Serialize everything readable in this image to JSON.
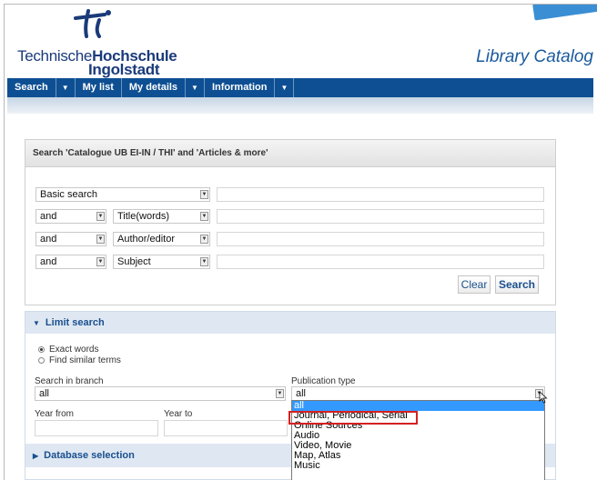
{
  "header": {
    "logo_line1_a": "Technische",
    "logo_line1_b": "Hochschule",
    "logo_line2": "Ingolstadt",
    "catalog_title": "Library Catalog"
  },
  "nav": {
    "items": [
      "Search",
      "My list",
      "My details",
      "Information"
    ],
    "arrow": "▼"
  },
  "search_panel": {
    "title": "Search 'Catalogue UB EI-IN / THI' and 'Articles & more'",
    "rows": [
      {
        "operator": "",
        "field": "Basic search"
      },
      {
        "operator": "and",
        "field": "Title(words)"
      },
      {
        "operator": "and",
        "field": "Author/editor"
      },
      {
        "operator": "and",
        "field": "Subject"
      }
    ],
    "clear_label": "Clear",
    "search_label": "Search"
  },
  "limit": {
    "title": "Limit search",
    "toggle_icon": "▼",
    "radio_exact": "Exact words",
    "radio_similar": "Find similar terms",
    "branch_label": "Search in branch",
    "branch_value": "all",
    "pubtype_label": "Publication type",
    "pubtype_value": "all",
    "year_from_label": "Year from",
    "year_to_label": "Year  to",
    "database_title": "Database selection",
    "database_icon": "▶"
  },
  "pubtype_options": [
    "all",
    "Journal, Periodical, Serial",
    "Online Sources",
    "Audio",
    "Video, Movie",
    "Map, Atlas",
    "Music"
  ],
  "colors": {
    "nav_bg": "#0e4f93",
    "brand": "#1a3a7a",
    "link": "#1a4f8f",
    "highlight": "#d62020"
  }
}
